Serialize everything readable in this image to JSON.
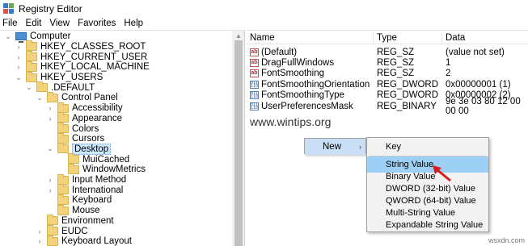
{
  "window": {
    "title": "Registry Editor"
  },
  "menu": [
    "File",
    "Edit",
    "View",
    "Favorites",
    "Help"
  ],
  "tree": [
    {
      "label": "Computer",
      "expander": "v",
      "icon": "computer-icon"
    },
    {
      "label": "HKEY_CLASSES_ROOT",
      "expander": ">",
      "icon": "folder-icon"
    },
    {
      "label": "HKEY_CURRENT_USER",
      "expander": ">",
      "icon": "folder-icon"
    },
    {
      "label": "HKEY_LOCAL_MACHINE",
      "expander": ">",
      "icon": "folder-icon"
    },
    {
      "label": "HKEY_USERS",
      "expander": "v",
      "icon": "folder-icon"
    },
    {
      "label": ".DEFAULT",
      "expander": "v",
      "icon": "folder-icon"
    },
    {
      "label": "Control Panel",
      "expander": "v",
      "icon": "folder-icon"
    },
    {
      "label": "Accessibility",
      "expander": ">",
      "icon": "folder-icon"
    },
    {
      "label": "Appearance",
      "expander": ">",
      "icon": "folder-icon"
    },
    {
      "label": "Colors",
      "expander": "",
      "icon": "folder-icon"
    },
    {
      "label": "Cursors",
      "expander": "",
      "icon": "folder-icon"
    },
    {
      "label": "Desktop",
      "expander": "v",
      "icon": "folder-icon",
      "selected": true
    },
    {
      "label": "MuiCached",
      "expander": "",
      "icon": "folder-icon"
    },
    {
      "label": "WindowMetrics",
      "expander": "",
      "icon": "folder-icon"
    },
    {
      "label": "Input Method",
      "expander": ">",
      "icon": "folder-icon"
    },
    {
      "label": "International",
      "expander": ">",
      "icon": "folder-icon"
    },
    {
      "label": "Keyboard",
      "expander": "",
      "icon": "folder-icon"
    },
    {
      "label": "Mouse",
      "expander": "",
      "icon": "folder-icon"
    },
    {
      "label": "Environment",
      "expander": "",
      "icon": "folder-icon"
    },
    {
      "label": "EUDC",
      "expander": ">",
      "icon": "folder-icon"
    },
    {
      "label": "Keyboard Layout",
      "expander": ">",
      "icon": "folder-icon"
    }
  ],
  "list": {
    "columns": [
      "Name",
      "Type",
      "Data"
    ],
    "rows": [
      {
        "name": "(Default)",
        "type": "REG_SZ",
        "data": "(value not set)",
        "icon": "string-value-icon"
      },
      {
        "name": "DragFullWindows",
        "type": "REG_SZ",
        "data": "1",
        "icon": "string-value-icon"
      },
      {
        "name": "FontSmoothing",
        "type": "REG_SZ",
        "data": "2",
        "icon": "string-value-icon"
      },
      {
        "name": "FontSmoothingOrientation",
        "type": "REG_DWORD",
        "data": "0x00000001 (1)",
        "icon": "binary-value-icon"
      },
      {
        "name": "FontSmoothingType",
        "type": "REG_DWORD",
        "data": "0x00000002 (2)",
        "icon": "binary-value-icon"
      },
      {
        "name": "UserPreferencesMask",
        "type": "REG_BINARY",
        "data": "9e 3e 03 80 12 00 00 00",
        "icon": "binary-value-icon"
      }
    ]
  },
  "watermark": "www.wintips.org",
  "context_menu": {
    "new_label": "New",
    "submenu": {
      "key_label": "Key",
      "items": [
        "String Value",
        "Binary Value",
        "DWORD (32-bit) Value",
        "QWORD (64-bit) Value",
        "Multi-String Value",
        "Expandable String Value"
      ],
      "highlighted": "String Value"
    }
  },
  "corner_watermark": "wsxdn.com"
}
